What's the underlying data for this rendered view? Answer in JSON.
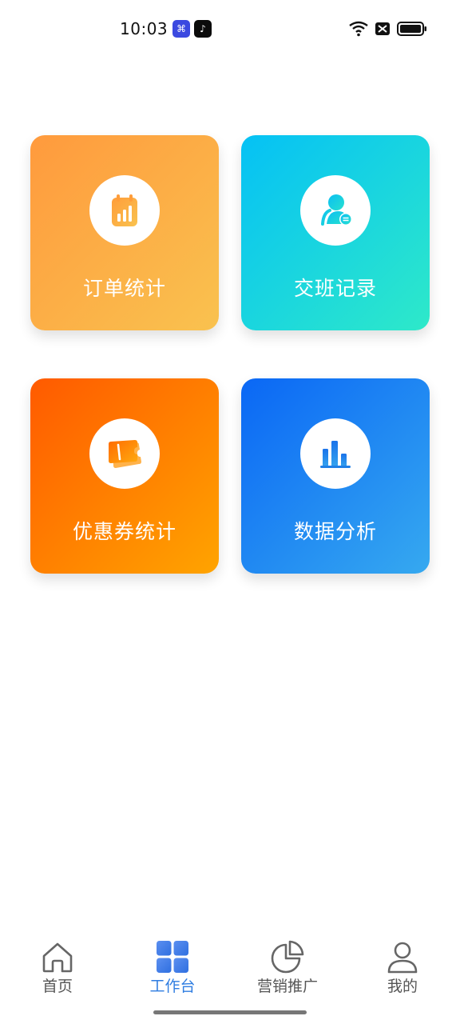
{
  "status_bar": {
    "time": "10:03"
  },
  "tiles": [
    {
      "label": "订单统计",
      "icon": "order-stats-icon",
      "icon_color": "#ffa53f"
    },
    {
      "label": "交班记录",
      "icon": "shift-handover-icon",
      "icon_color": "#11c3d6"
    },
    {
      "label": "优惠券统计",
      "icon": "coupon-icon",
      "icon_color": "#ff7a10"
    },
    {
      "label": "数据分析",
      "icon": "bar-chart-icon",
      "icon_color": "#1f7fe6"
    }
  ],
  "bottom_nav": {
    "active_index": 1,
    "active_color": "#2f7de1",
    "items": [
      {
        "label": "首页",
        "icon": "home-icon"
      },
      {
        "label": "工作台",
        "icon": "workbench-grid-icon"
      },
      {
        "label": "营销推广",
        "icon": "pie-chart-icon"
      },
      {
        "label": "我的",
        "icon": "user-icon"
      }
    ]
  }
}
